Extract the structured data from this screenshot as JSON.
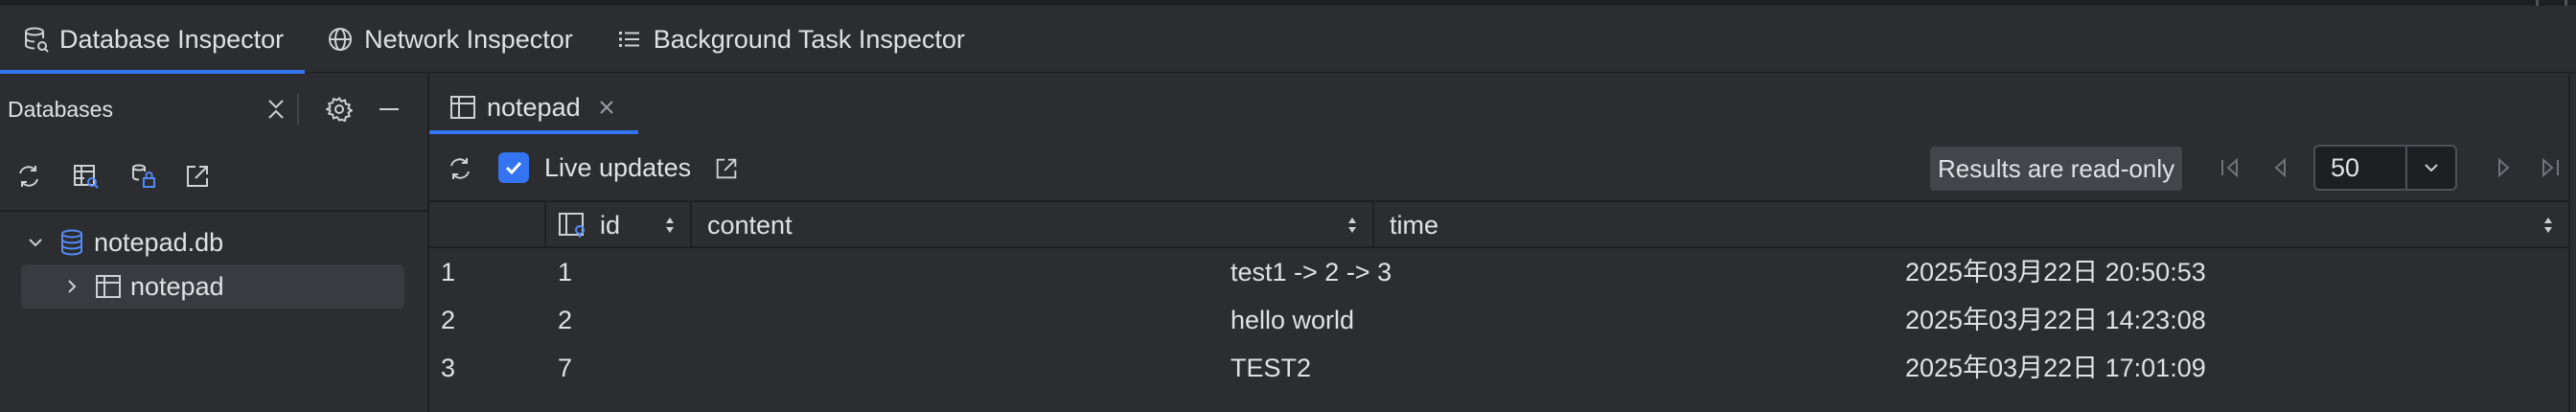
{
  "inspector_tabs": [
    {
      "label": "Database Inspector",
      "active": true
    },
    {
      "label": "Network Inspector",
      "active": false
    },
    {
      "label": "Background Task Inspector",
      "active": false
    }
  ],
  "databases_panel": {
    "title": "Databases",
    "tree": {
      "database": "notepad.db",
      "tables": [
        "notepad"
      ]
    }
  },
  "table_tab": {
    "label": "notepad"
  },
  "toolbar": {
    "live_updates_label": "Live updates",
    "live_updates_checked": true,
    "readonly_label": "Results are read-only",
    "page_size": "50"
  },
  "grid": {
    "columns": [
      "id",
      "content",
      "time"
    ],
    "rows": [
      {
        "index": "1",
        "id": "1",
        "content": "test1 -> 2 -> 3",
        "time": "2025年03月22日 20:50:53"
      },
      {
        "index": "2",
        "id": "2",
        "content": "hello world",
        "time": "2025年03月22日 14:23:08"
      },
      {
        "index": "3",
        "id": "7",
        "content": "TEST2",
        "time": "2025年03月22日 17:01:09"
      }
    ]
  },
  "colors": {
    "background": "#2b2d30",
    "accent": "#3574f0",
    "text": "#dfe1e5",
    "muted": "#6f737a"
  }
}
